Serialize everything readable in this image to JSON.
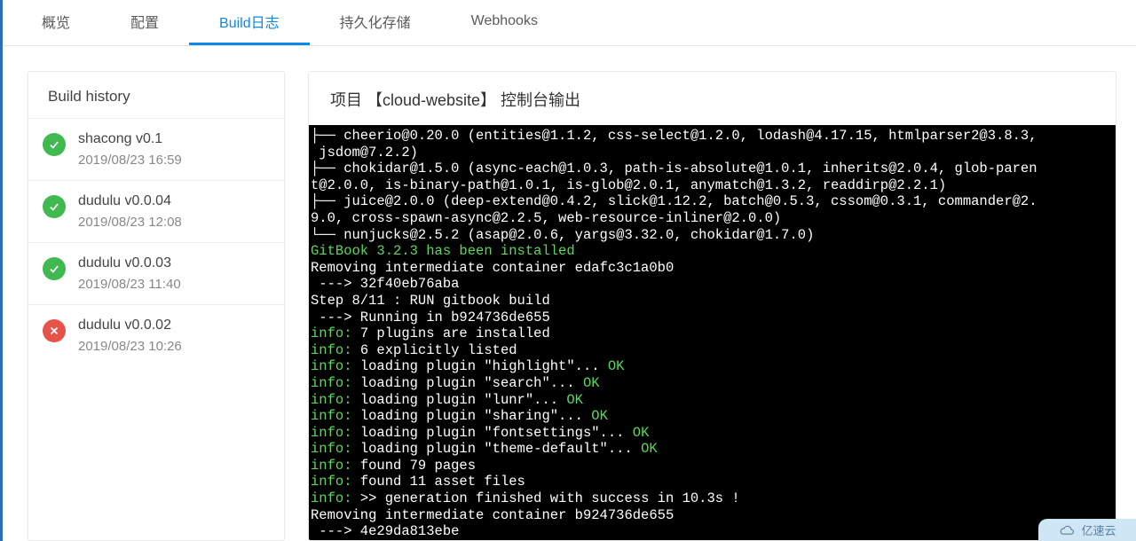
{
  "tabs": {
    "overview": "概览",
    "config": "配置",
    "buildlog": "Build日志",
    "storage": "持久化存储",
    "webhooks": "Webhooks"
  },
  "history": {
    "title": "Build history",
    "items": [
      {
        "status": "success",
        "version": "shacong v0.1",
        "time": "2019/08/23 16:59"
      },
      {
        "status": "success",
        "version": "dudulu v0.0.04",
        "time": "2019/08/23 12:08"
      },
      {
        "status": "success",
        "version": "dudulu v0.0.03",
        "time": "2019/08/23 11:40"
      },
      {
        "status": "fail",
        "version": "dudulu v0.0.02",
        "time": "2019/08/23 10:26"
      }
    ]
  },
  "console": {
    "title": "项目 【cloud-website】 控制台输出",
    "lines": [
      {
        "text": "├── cheerio@0.20.0 (entities@1.1.2, css-select@1.2.0, lodash@4.17.15, htmlparser2@3.8.3, jsdom@7.2.2)"
      },
      {
        "text": "├── chokidar@1.5.0 (async-each@1.0.3, path-is-absolute@1.0.1, inherits@2.0.4, glob-parent@2.0.0, is-binary-path@1.0.1, is-glob@2.0.1, anymatch@1.3.2, readdirp@2.2.1)"
      },
      {
        "text": "├── juice@2.0.0 (deep-extend@0.4.2, slick@1.12.2, batch@0.5.3, cssom@0.3.1, commander@2.9.0, cross-spawn-async@2.2.5, web-resource-inliner@2.0.0)"
      },
      {
        "text": "└── nunjucks@2.5.2 (asap@2.0.6, yargs@3.32.0, chokidar@1.7.0)"
      },
      {
        "text": ""
      },
      {
        "text": "GitBook 3.2.3 has been installed",
        "green": true
      },
      {
        "text": "Removing intermediate container edafc3c1a0b0"
      },
      {
        "text": " ---> 32f40eb76aba"
      },
      {
        "text": "Step 8/11 : RUN gitbook build"
      },
      {
        "text": " ---> Running in b924736de655"
      },
      {
        "prefix": "info:",
        "text": " 7 plugins are installed"
      },
      {
        "prefix": "info:",
        "text": " 6 explicitly listed"
      },
      {
        "prefix": "info:",
        "text": " loading plugin \"highlight\"... ",
        "suffix": "OK"
      },
      {
        "prefix": "info:",
        "text": " loading plugin \"search\"... ",
        "suffix": "OK"
      },
      {
        "prefix": "info:",
        "text": " loading plugin \"lunr\"... ",
        "suffix": "OK"
      },
      {
        "prefix": "info:",
        "text": " loading plugin \"sharing\"... ",
        "suffix": "OK"
      },
      {
        "prefix": "info:",
        "text": " loading plugin \"fontsettings\"... ",
        "suffix": "OK"
      },
      {
        "prefix": "info:",
        "text": " loading plugin \"theme-default\"... ",
        "suffix": "OK"
      },
      {
        "prefix": "info:",
        "text": " found 79 pages"
      },
      {
        "prefix": "info:",
        "text": " found 11 asset files"
      },
      {
        "prefix": "info:",
        "text": " >> generation finished with success in 10.3s !"
      },
      {
        "text": "Removing intermediate container b924736de655"
      },
      {
        "text": " ---> 4e29da813ebe"
      }
    ]
  },
  "watermark": {
    "text": "亿速云"
  }
}
